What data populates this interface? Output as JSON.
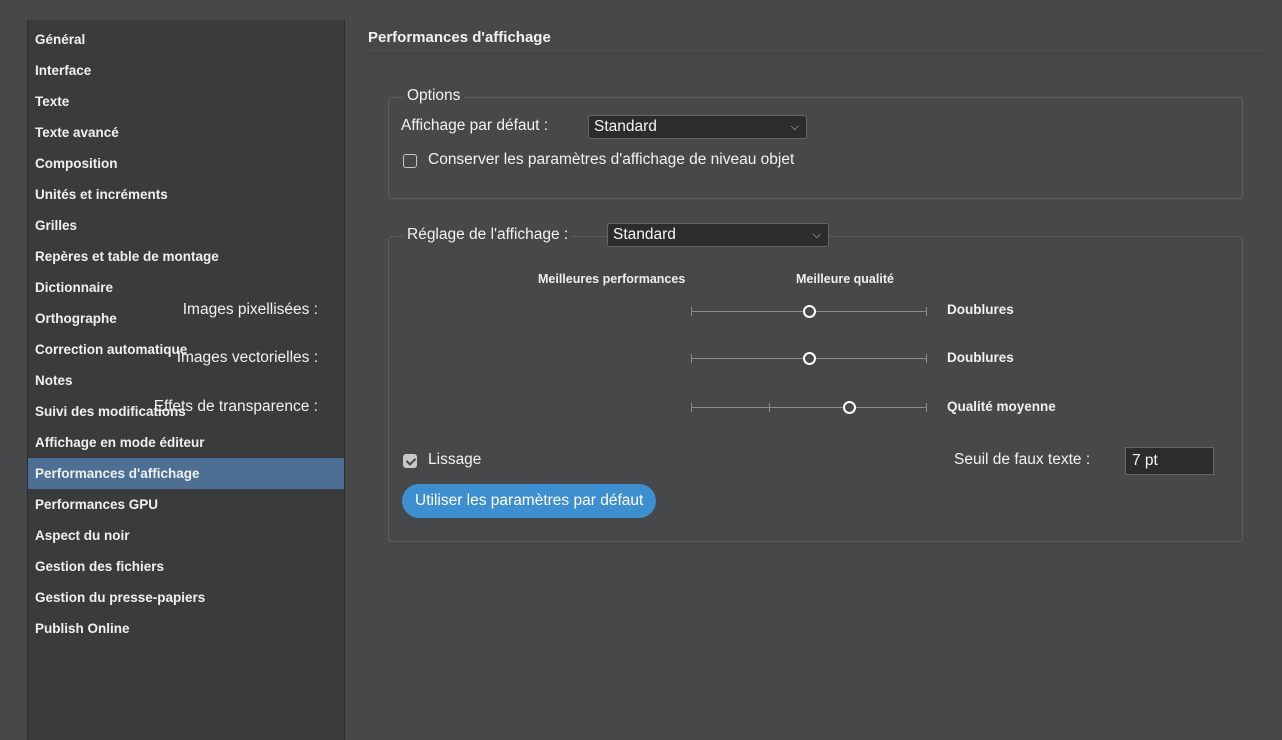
{
  "sidebar": {
    "items": [
      {
        "label": "Général"
      },
      {
        "label": "Interface"
      },
      {
        "label": "Texte"
      },
      {
        "label": "Texte avancé"
      },
      {
        "label": "Composition"
      },
      {
        "label": "Unités et incréments"
      },
      {
        "label": "Grilles"
      },
      {
        "label": "Repères et table de montage"
      },
      {
        "label": "Dictionnaire"
      },
      {
        "label": "Orthographe"
      },
      {
        "label": "Correction automatique"
      },
      {
        "label": "Notes"
      },
      {
        "label": "Suivi des modifications"
      },
      {
        "label": "Affichage en mode éditeur"
      },
      {
        "label": "Performances d'affichage"
      },
      {
        "label": "Performances GPU"
      },
      {
        "label": "Aspect du noir"
      },
      {
        "label": "Gestion des fichiers"
      },
      {
        "label": "Gestion du presse-papiers"
      },
      {
        "label": "Publish Online"
      }
    ],
    "active_index": 14
  },
  "main": {
    "title": "Performances d'affichage",
    "options": {
      "legend": "Options",
      "default_view_label": "Affichage par défaut :",
      "default_view_value": "Standard",
      "preserve_checkbox_label": "Conserver les paramètres d'affichage de niveau objet",
      "preserve_checked": false
    },
    "adjust": {
      "legend_label": "Réglage de l'affichage :",
      "legend_value": "Standard",
      "best_performance_label": "Meilleures performances",
      "best_quality_label": "Meilleure qualité",
      "sliders": [
        {
          "label": "Images pixellisées :",
          "value_label": "Doublures",
          "position": 0.5
        },
        {
          "label": "Images vectorielles :",
          "value_label": "Doublures",
          "position": 0.5
        },
        {
          "label": "Effets de transparence :",
          "value_label": "Qualité moyenne",
          "position": 0.67
        }
      ],
      "antialias_label": "Lissage",
      "antialias_checked": true,
      "greek_label": "Seuil de faux texte :",
      "greek_value": "7 pt",
      "use_defaults_button": "Utiliser les paramètres par défaut"
    }
  },
  "colors": {
    "accent": "#3d8fd0",
    "sidebar_active": "#4d6f93",
    "background": "#474849"
  }
}
